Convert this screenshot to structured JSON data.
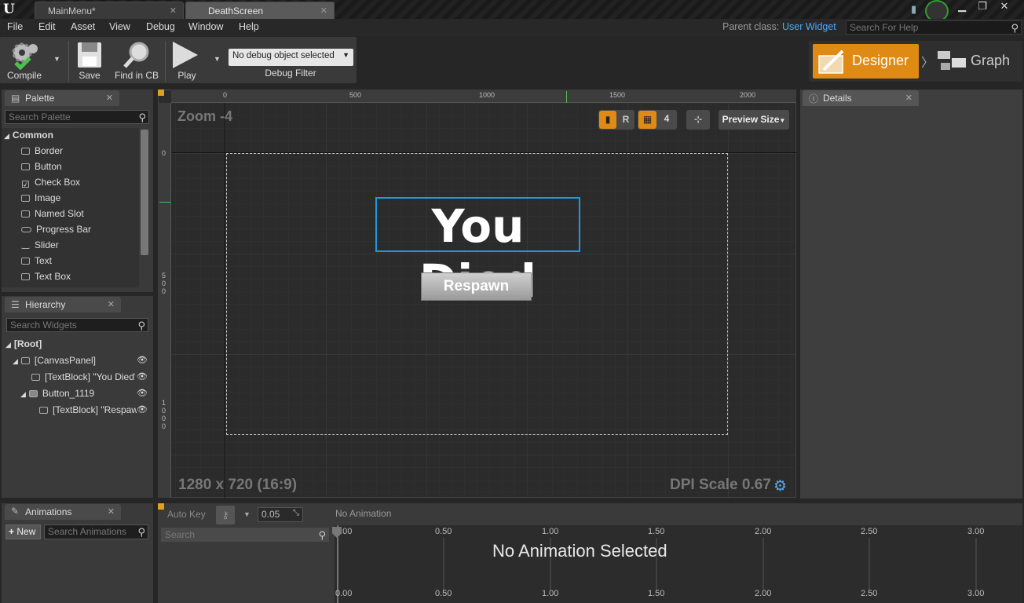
{
  "tabs": [
    {
      "label": "MainMenu*"
    },
    {
      "label": "DeathScreen"
    }
  ],
  "menu": [
    "File",
    "Edit",
    "Asset",
    "View",
    "Debug",
    "Window",
    "Help"
  ],
  "parent_class_label": "Parent class:",
  "parent_class_value": "User Widget",
  "search_help_placeholder": "Search For Help",
  "toolbar": {
    "compile": "Compile",
    "save": "Save",
    "find_in_cb": "Find in CB",
    "play": "Play",
    "debug_object": "No debug object selected",
    "debug_filter": "Debug Filter"
  },
  "modes": {
    "designer": "Designer",
    "graph": "Graph"
  },
  "palette": {
    "tab": "Palette",
    "search_placeholder": "Search Palette",
    "category": "Common",
    "items": [
      "Border",
      "Button",
      "Check Box",
      "Image",
      "Named Slot",
      "Progress Bar",
      "Slider",
      "Text",
      "Text Box"
    ]
  },
  "hierarchy": {
    "tab": "Hierarchy",
    "search_placeholder": "Search Widgets",
    "items": [
      "[Root]",
      "[CanvasPanel]",
      "[TextBlock] \"You Died\"",
      "Button_1119",
      "[TextBlock] \"Respaw"
    ]
  },
  "details": {
    "tab": "Details"
  },
  "viewport": {
    "zoom": "Zoom -4",
    "resolution": "1280 x 720 (16:9)",
    "dpi": "DPI Scale 0.67",
    "r_button": "R",
    "grid_value": "4",
    "preview_size": "Preview Size",
    "ruler_h": [
      "0",
      "500",
      "1000",
      "1500",
      "2000"
    ],
    "ruler_v": [
      "0",
      "5",
      "0",
      "0",
      "1",
      "0",
      "0",
      "0"
    ],
    "title_text": "You Died",
    "button_text": "Respawn"
  },
  "animations": {
    "tab": "Animations",
    "new_button": "New",
    "search_placeholder": "Search Animations",
    "auto_key": "Auto Key",
    "snap_value": "0.05",
    "no_animation": "No Animation",
    "track_search": "Search",
    "no_selected": "No Animation Selected",
    "ticks": [
      "0.00",
      "0.50",
      "1.00",
      "1.50",
      "2.00",
      "2.50",
      "3.00"
    ]
  }
}
